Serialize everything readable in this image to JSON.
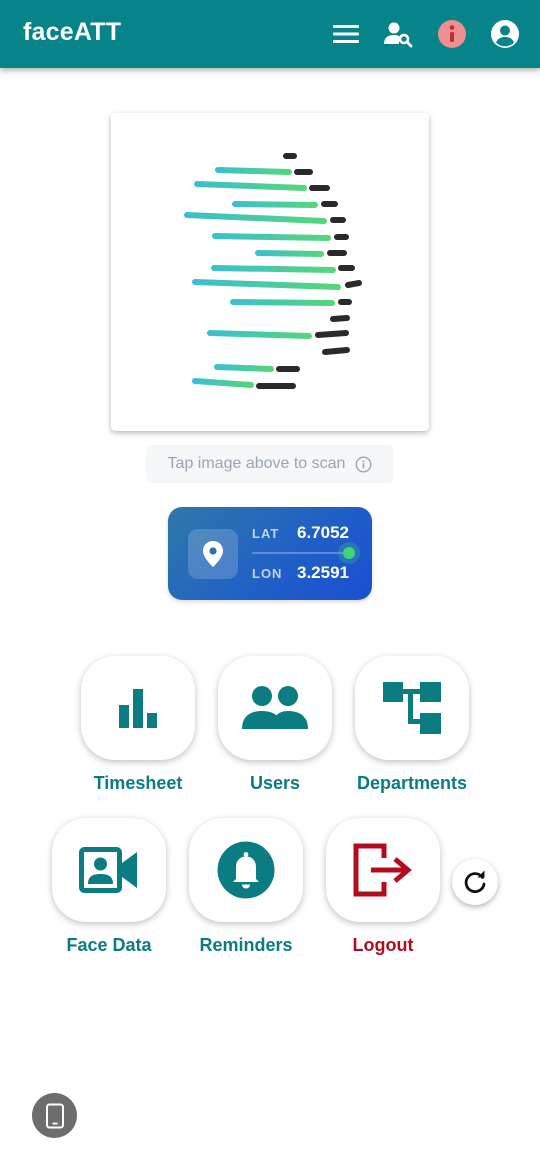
{
  "app": {
    "title": "faceATT",
    "accent": "#07848a"
  },
  "appbar": {
    "icons": [
      {
        "name": "menu-icon"
      },
      {
        "name": "user-search-icon"
      },
      {
        "name": "info-icon",
        "color": "#ef8f8f"
      },
      {
        "name": "account-icon"
      }
    ]
  },
  "scan": {
    "image_name": "fingerprint-graphic",
    "hint": "Tap image above to scan",
    "hint_icon": "info-outline-icon"
  },
  "location": {
    "lat_label": "LAT",
    "lat_value": "6.7052",
    "lon_label": "LON",
    "lon_value": "3.2591",
    "icon": "location-pin-icon"
  },
  "menu": {
    "tiles": [
      {
        "label": "Timesheet",
        "icon": "bar-chart-icon"
      },
      {
        "label": "Users",
        "icon": "users-icon"
      },
      {
        "label": "Departments",
        "icon": "org-chart-icon"
      },
      {
        "label": "Face Data",
        "icon": "video-contact-icon"
      },
      {
        "label": "Reminders",
        "icon": "bell-icon"
      },
      {
        "label": "Logout",
        "icon": "logout-icon",
        "color": "#b10d1f"
      }
    ],
    "refresh_icon": "refresh-icon"
  },
  "footer": {
    "device_icon": "smartphone-icon"
  }
}
